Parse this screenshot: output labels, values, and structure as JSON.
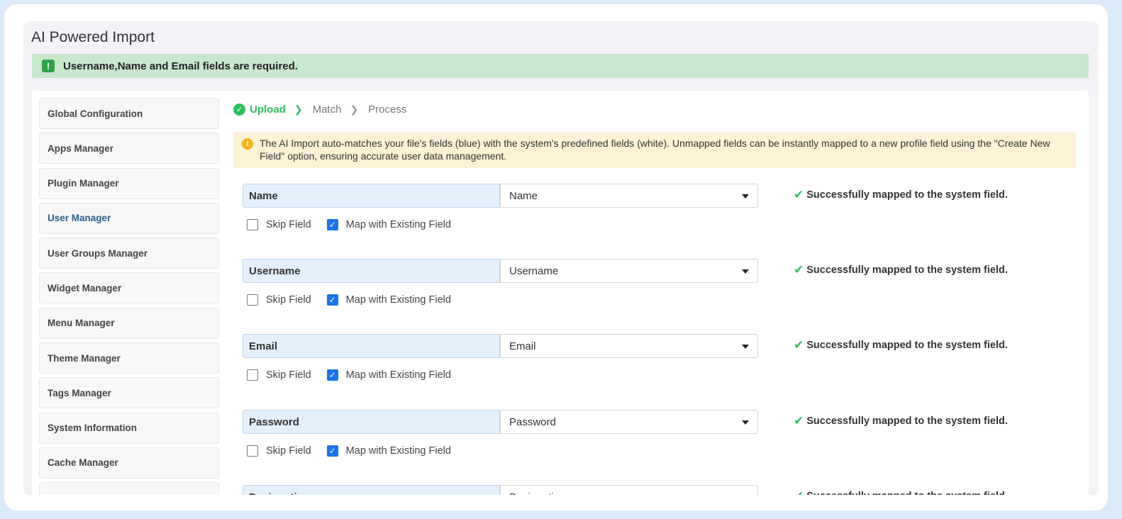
{
  "page": {
    "title": "AI Powered Import"
  },
  "alert": {
    "text": "Username,Name and Email fields are required.",
    "icon": "exclamation-icon"
  },
  "sidebar": {
    "items": [
      {
        "label": "Global Configuration",
        "active": false
      },
      {
        "label": "Apps Manager",
        "active": false
      },
      {
        "label": "Plugin Manager",
        "active": false
      },
      {
        "label": "User Manager",
        "active": true
      },
      {
        "label": "User Groups Manager",
        "active": false
      },
      {
        "label": "Widget Manager",
        "active": false
      },
      {
        "label": "Menu Manager",
        "active": false
      },
      {
        "label": "Theme Manager",
        "active": false
      },
      {
        "label": "Tags Manager",
        "active": false
      },
      {
        "label": "System Information",
        "active": false
      },
      {
        "label": "Cache Manager",
        "active": false
      },
      {
        "label": "",
        "active": false
      }
    ]
  },
  "steps": [
    {
      "label": "Upload",
      "done": true
    },
    {
      "label": "Match",
      "done": false
    },
    {
      "label": "Process",
      "done": false
    }
  ],
  "info": {
    "text": "The AI Import auto-matches your file's fields (blue) with the system's predefined fields (white). Unmapped fields can be instantly mapped to a new profile field using the \"Create New Field\" option, ensuring accurate user data management."
  },
  "options": {
    "skip_label": "Skip Field",
    "map_label": "Map with Existing Field"
  },
  "status_text": "Successfully mapped to the system field.",
  "fields": [
    {
      "label": "Name",
      "selected": "Name",
      "skip": false,
      "map_existing": true
    },
    {
      "label": "Username",
      "selected": "Username",
      "skip": false,
      "map_existing": true
    },
    {
      "label": "Email",
      "selected": "Email",
      "skip": false,
      "map_existing": true
    },
    {
      "label": "Password",
      "selected": "Password",
      "skip": false,
      "map_existing": true
    },
    {
      "label": "Designation",
      "selected": "Designation",
      "skip": false,
      "map_existing": true
    }
  ],
  "colors": {
    "accent_green": "#2ebd5b",
    "checkbox_blue": "#1a73e8",
    "alert_bg": "#c9e7cc",
    "info_bg": "#fdf1d6"
  }
}
